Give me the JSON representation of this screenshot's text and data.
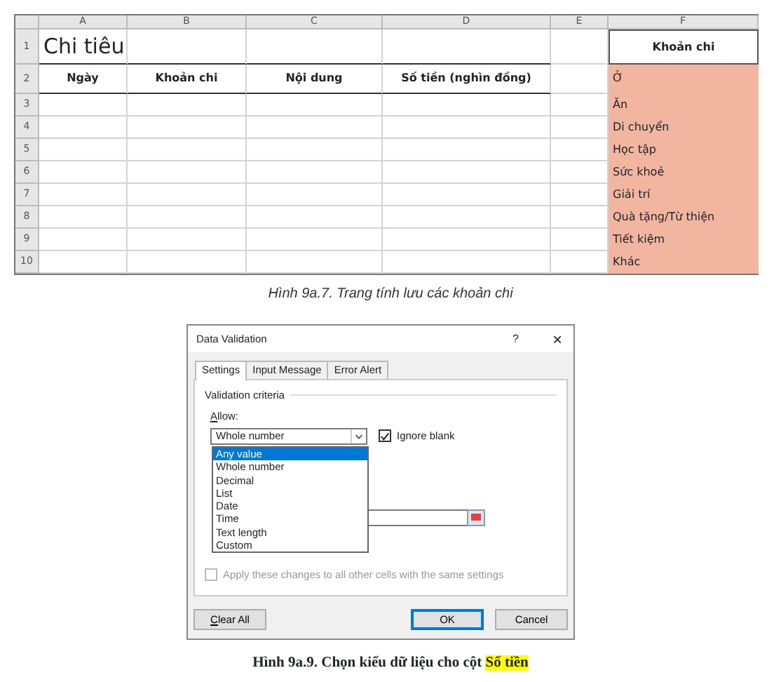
{
  "sheet": {
    "column_headers": [
      "A",
      "B",
      "C",
      "D",
      "E",
      "F"
    ],
    "row_headers": [
      "1",
      "2",
      "3",
      "4",
      "5",
      "6",
      "7",
      "8",
      "9",
      "10"
    ],
    "title": "Chi tiêu",
    "headers": [
      "Ngày",
      "Khoản chi",
      "Nội dung",
      "Số tiền (nghìn đồng)"
    ],
    "category_header": "Khoản chi",
    "categories": [
      "Ở",
      "Ăn",
      "Di chuyển",
      "Học tập",
      "Sức khoẻ",
      "Giải trí",
      "Quà tặng/Từ thiện",
      "Tiết kiệm",
      "Khác"
    ]
  },
  "caption_1": "Hình 9a.7. Trang tính lưu các khoản chi",
  "dialog": {
    "title": "Data Validation",
    "help": "?",
    "close": "×",
    "tabs": [
      {
        "label": "Settings",
        "selected": true
      },
      {
        "label": "Input Message",
        "selected": false
      },
      {
        "label": "Error Alert",
        "selected": false
      }
    ],
    "group_label": "Validation criteria",
    "allow_label": "Allow:",
    "allow_value": "Whole number",
    "ignore_blank": {
      "label": "Ignore blank",
      "checked": true
    },
    "options": [
      {
        "label": "Any value",
        "selected": true
      },
      {
        "label": "Whole number",
        "selected": false
      },
      {
        "label": "Decimal",
        "selected": false
      },
      {
        "label": "List",
        "selected": false
      },
      {
        "label": "Date",
        "selected": false
      },
      {
        "label": "Time",
        "selected": false
      },
      {
        "label": "Text length",
        "selected": false
      },
      {
        "label": "Custom",
        "selected": false
      }
    ],
    "apply_all": {
      "label": "Apply these changes to all other cells with the same settings",
      "checked": false,
      "disabled": true
    },
    "buttons": [
      {
        "label": "Clear All",
        "default": false
      },
      {
        "label": "OK",
        "default": true
      },
      {
        "label": "Cancel",
        "default": false
      }
    ]
  },
  "caption_2": {
    "text": "Hình 9a.9. Chọn kiểu dữ liệu cho cột",
    "highlight": "Số tiền"
  }
}
